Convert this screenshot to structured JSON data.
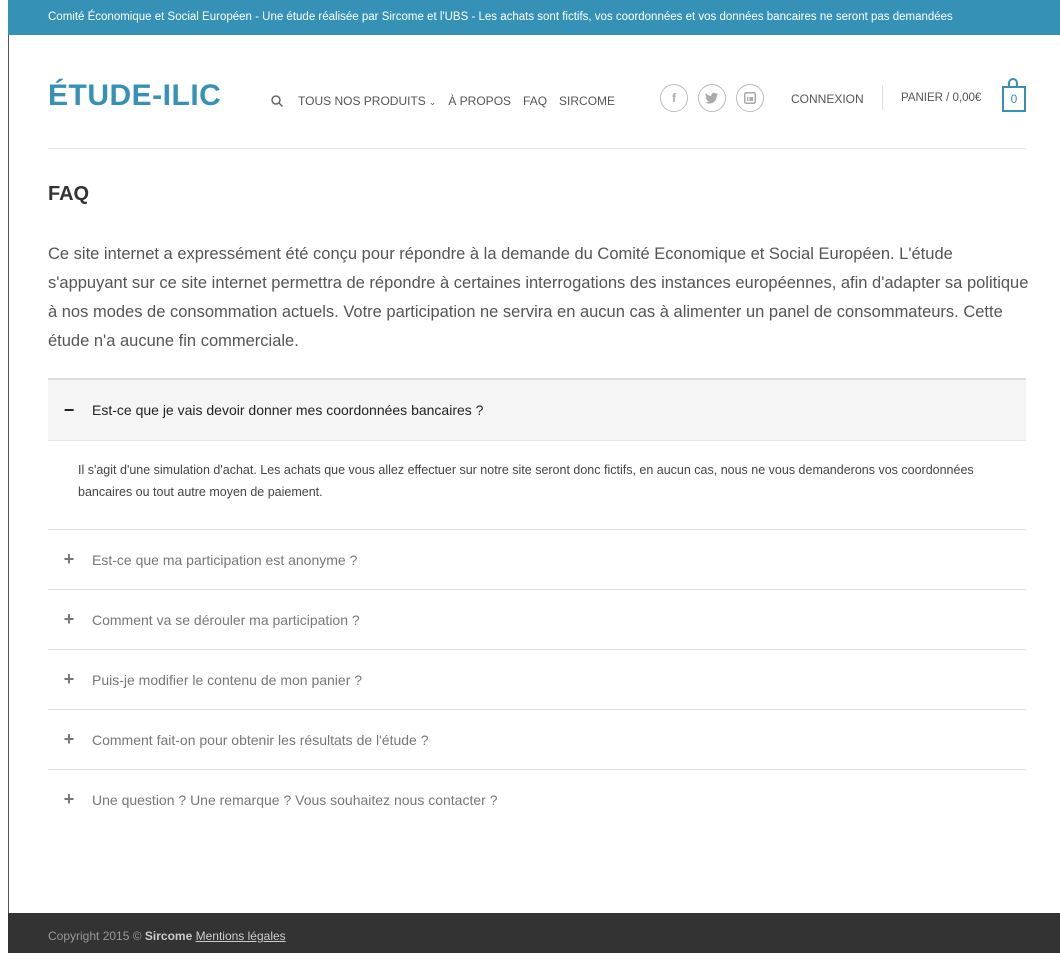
{
  "topbar": {
    "text": "Comité Économique et Social Européen - Une étude réalisée par Sircome et l'UBS - Les achats sont fictifs, vos coordonnées et vos données bancaires ne seront pas demandées"
  },
  "header": {
    "logo": "ÉTUDE-ILIC",
    "nav": [
      {
        "label": "TOUS NOS PRODUITS"
      },
      {
        "label": "À PROPOS"
      },
      {
        "label": "FAQ"
      },
      {
        "label": "SIRCOME"
      }
    ],
    "social": [
      {
        "icon": "facebook-icon",
        "glyph": "f"
      },
      {
        "icon": "twitter-icon",
        "glyph": "t"
      },
      {
        "icon": "linkedin-icon",
        "glyph": "in"
      }
    ],
    "login": "CONNEXION",
    "cart_label": "PANIER / 0,00€",
    "cart_count": "0"
  },
  "page": {
    "title": "FAQ",
    "intro": "Ce site internet a expressément été conçu pour répondre à la demande du Comité Economique et Social Européen. L'étude s'appuyant sur ce site internet permettra de répondre à certaines interrogations des instances européennes, afin d'adapter sa politique à nos modes de consommation actuels. Votre participation ne servira en aucun cas à alimenter un panel de consommateurs. Cette étude n'a aucune fin commerciale."
  },
  "faq": [
    {
      "question": "Est-ce que je vais devoir donner mes coordonnées bancaires ?",
      "answer": "Il s'agit d'une simulation d'achat. Les achats que vous allez effectuer sur notre site seront donc fictifs, en aucun cas, nous ne vous demanderons vos coordonnées bancaires ou tout autre moyen de paiement.",
      "open": true
    },
    {
      "question": "Est-ce que ma participation est anonyme ?",
      "open": false
    },
    {
      "question": "Comment va se dérouler ma participation ?",
      "open": false
    },
    {
      "question": "Puis-je modifier le contenu de mon panier ?",
      "open": false
    },
    {
      "question": "Comment fait-on pour obtenir les résultats de l'étude ?",
      "open": false
    },
    {
      "question": "Une question ? Une remarque ? Vous souhaitez nous contacter ?",
      "open": false
    }
  ],
  "footer": {
    "copyright": "Copyright 2015 ©",
    "brand": "Sircome",
    "legal_link": "Mentions légales"
  },
  "colors": {
    "accent": "#3592b6",
    "footer_bg": "#333333"
  }
}
